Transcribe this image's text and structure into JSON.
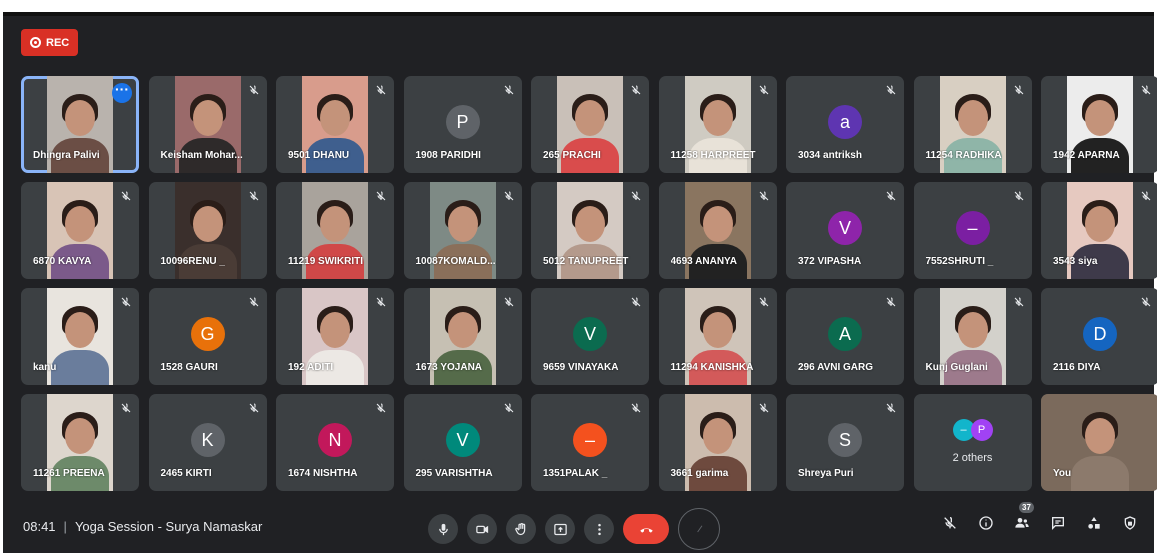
{
  "recording": {
    "label": "REC",
    "color": "#d93025"
  },
  "tiles": [
    {
      "name": "Dhingra Palivi",
      "kind": "video",
      "bg": "#b9b3ad",
      "shirt": "#6b4e45",
      "active": true,
      "menu": true
    },
    {
      "name": "Keisham Mohar...",
      "kind": "video",
      "bg": "#9a6a6a",
      "shirt": "#2e2a2a"
    },
    {
      "name": "9501 DHANU",
      "kind": "video",
      "bg": "#d89c8c",
      "shirt": "#3f5f8e"
    },
    {
      "name": "1908 PARIDHI",
      "kind": "avatar",
      "initial": "P",
      "color": "#5f6368"
    },
    {
      "name": "265 PRACHI",
      "kind": "video",
      "bg": "#c9c0b8",
      "shirt": "#d94c4c"
    },
    {
      "name": "11258 HARPREET",
      "kind": "video",
      "bg": "#cfcbc2",
      "shirt": "#e8e2d8"
    },
    {
      "name": "3034 antriksh",
      "kind": "avatar",
      "initial": "a",
      "color": "#5e35b1"
    },
    {
      "name": "11254 RADHIKA",
      "kind": "video",
      "bg": "#d8cfc2",
      "shirt": "#8fb5a8"
    },
    {
      "name": "1942 APARNA",
      "kind": "video",
      "bg": "#ececec",
      "shirt": "#222222"
    },
    {
      "name": "6870 KAVYA",
      "kind": "video",
      "bg": "#d8c4b6",
      "shirt": "#7b5a8a"
    },
    {
      "name": "10096RENU _",
      "kind": "video",
      "bg": "#3a2f2c",
      "shirt": "#4a3c36"
    },
    {
      "name": "11219 SWIKRITI",
      "kind": "video",
      "bg": "#a9a39c",
      "shirt": "#d04848"
    },
    {
      "name": "10087KOMALD...",
      "kind": "video",
      "bg": "#7e8a85",
      "shirt": "#8a6f5a"
    },
    {
      "name": "5012 TANUPREET",
      "kind": "video",
      "bg": "#d4cac3",
      "shirt": "#b49a8c"
    },
    {
      "name": "4693 ANANYA",
      "kind": "video",
      "bg": "#8a7560",
      "shirt": "#222222"
    },
    {
      "name": "372 VIPASHA",
      "kind": "avatar",
      "initial": "V",
      "color": "#8e24aa"
    },
    {
      "name": "7552SHRUTI _",
      "kind": "avatar",
      "initial": "–",
      "color": "#7b1fa2"
    },
    {
      "name": "3543 siya",
      "kind": "video",
      "bg": "#e6c9c0",
      "shirt": "#3e3a4a"
    },
    {
      "name": "kanu",
      "kind": "video",
      "bg": "#e8e4de",
      "shirt": "#6a7d9c"
    },
    {
      "name": "1528 GAURI",
      "kind": "avatar",
      "initial": "G",
      "color": "#e8710a"
    },
    {
      "name": "192 ADITI",
      "kind": "video",
      "bg": "#d9c6c6",
      "shirt": "#ece8e4"
    },
    {
      "name": "1673 YOJANA",
      "kind": "video",
      "bg": "#c6c0b3",
      "shirt": "#556b4a"
    },
    {
      "name": "9659 VINAYAKA",
      "kind": "avatar",
      "initial": "V",
      "color": "#0b6b4f"
    },
    {
      "name": "11294 KANISHKA",
      "kind": "video",
      "bg": "#cfc4b9",
      "shirt": "#d35a5a"
    },
    {
      "name": "296 AVNI GARG",
      "kind": "avatar",
      "initial": "A",
      "color": "#0b6b4f"
    },
    {
      "name": "Kunj Guglani",
      "kind": "video",
      "bg": "#d3d1cb",
      "shirt": "#9d7a8c"
    },
    {
      "name": "2116 DIYA",
      "kind": "avatar",
      "initial": "D",
      "color": "#1565c0"
    },
    {
      "name": "11261 PREENA",
      "kind": "video",
      "bg": "#ddd6cd",
      "shirt": "#6d8a6a"
    },
    {
      "name": "2465 KIRTI",
      "kind": "avatar",
      "initial": "K",
      "color": "#5f6368"
    },
    {
      "name": "1674 NISHTHA",
      "kind": "avatar",
      "initial": "N",
      "color": "#c2185b"
    },
    {
      "name": "295 VARISHTHA",
      "kind": "avatar",
      "initial": "V",
      "color": "#00897b"
    },
    {
      "name": "1351PALAK _",
      "kind": "avatar",
      "initial": "–",
      "color": "#f4511e"
    },
    {
      "name": "3661 garima",
      "kind": "video",
      "bg": "#ccbcae",
      "shirt": "#6e4a3e"
    },
    {
      "name": "Shreya Puri",
      "kind": "avatar",
      "initial": "S",
      "color": "#5f6368"
    },
    {
      "name": "",
      "kind": "others",
      "label": "2 others",
      "minis": [
        {
          "initial": "–",
          "color": "#12b5cb"
        },
        {
          "initial": "P",
          "color": "#a142f4"
        }
      ]
    },
    {
      "name": "You",
      "kind": "video",
      "bg": "#7b6a5c",
      "shirt": "#8c7a6c",
      "self": true
    }
  ],
  "bottom": {
    "time": "08:41",
    "separator": "|",
    "meeting_title": "Yoga Session - Surya Namaskar",
    "participants_count": "37"
  },
  "colors": {
    "end_call": "#ea4335",
    "active_outline": "#8ab4f8",
    "background": "#202124",
    "tile": "#3c4043"
  }
}
